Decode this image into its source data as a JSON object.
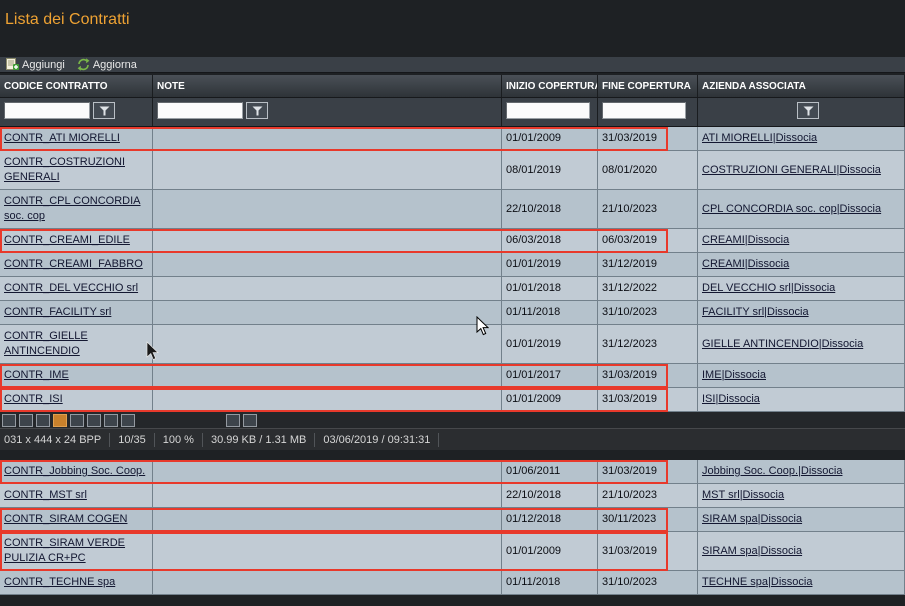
{
  "page": {
    "title": "Lista dei Contratti"
  },
  "toolbar": {
    "add_label": "Aggiungi",
    "refresh_label": "Aggiorna"
  },
  "table": {
    "columns": [
      "CODICE CONTRATTO",
      "NOTE",
      "INIZIO COPERTURA",
      "FINE COPERTURA",
      "AZIENDA ASSOCIATA"
    ],
    "filters": {
      "codice_value": "",
      "note_value": "",
      "inizio_value": "",
      "fine_value": ""
    },
    "action_label": "Dissocia",
    "separator": " | ",
    "rows_top": [
      {
        "codice": "CONTR_ATI MIORELLI",
        "note": "",
        "inizio": "01/01/2009",
        "fine": "31/03/2019",
        "azienda": "ATI MIORELLI",
        "highlight": true
      },
      {
        "codice": "CONTR_COSTRUZIONI GENERALI",
        "note": "",
        "inizio": "08/01/2019",
        "fine": "08/01/2020",
        "azienda": "COSTRUZIONI GENERALI",
        "highlight": false
      },
      {
        "codice": "CONTR_CPL CONCORDIA soc. cop",
        "note": "",
        "inizio": "22/10/2018",
        "fine": "21/10/2023",
        "azienda": "CPL CONCORDIA soc. cop",
        "highlight": false
      },
      {
        "codice": "CONTR_CREAMI_EDILE",
        "note": "",
        "inizio": "06/03/2018",
        "fine": "06/03/2019",
        "azienda": "CREAMI",
        "highlight": true
      },
      {
        "codice": "CONTR_CREAMI_FABBRO",
        "note": "",
        "inizio": "01/01/2019",
        "fine": "31/12/2019",
        "azienda": "CREAMI",
        "highlight": false
      },
      {
        "codice": "CONTR_DEL VECCHIO srl",
        "note": "",
        "inizio": "01/01/2018",
        "fine": "31/12/2022",
        "azienda": "DEL VECCHIO srl",
        "highlight": false
      },
      {
        "codice": "CONTR_FACILITY srl",
        "note": "",
        "inizio": "01/11/2018",
        "fine": "31/10/2023",
        "azienda": "FACILITY srl",
        "highlight": false
      },
      {
        "codice": "CONTR_GIELLE ANTINCENDIO",
        "note": "",
        "inizio": "01/01/2019",
        "fine": "31/12/2023",
        "azienda": "GIELLE ANTINCENDIO",
        "highlight": false
      },
      {
        "codice": "CONTR_IME",
        "note": "",
        "inizio": "01/01/2017",
        "fine": "31/03/2019",
        "azienda": "IME",
        "highlight": true
      },
      {
        "codice": "CONTR_ISI",
        "note": "",
        "inizio": "01/01/2009",
        "fine": "31/03/2019",
        "azienda": "ISI",
        "highlight": true
      }
    ],
    "rows_bottom": [
      {
        "codice": "CONTR_Jobbing Soc. Coop.",
        "note": "",
        "inizio": "01/06/2011",
        "fine": "31/03/2019",
        "azienda": "Jobbing Soc. Coop.",
        "highlight": true
      },
      {
        "codice": "CONTR_MST srl",
        "note": "",
        "inizio": "22/10/2018",
        "fine": "21/10/2023",
        "azienda": "MST srl",
        "highlight": false
      },
      {
        "codice": "CONTR_SIRAM COGEN",
        "note": "",
        "inizio": "01/12/2018",
        "fine": "30/11/2023",
        "azienda": "SIRAM spa",
        "highlight": true
      },
      {
        "codice": "CONTR_SIRAM VERDE PULIZIA CR+PC",
        "note": "",
        "inizio": "01/01/2009",
        "fine": "31/03/2019",
        "azienda": "SIRAM spa",
        "highlight": true
      },
      {
        "codice": "CONTR_TECHNE spa",
        "note": "",
        "inizio": "01/11/2018",
        "fine": "31/10/2023",
        "azienda": "TECHNE spa",
        "highlight": false
      }
    ]
  },
  "statusbar": {
    "items": [
      "031 x 444 x 24 BPP",
      "10/35",
      "100 %",
      "30.99 KB / 1.31 MB",
      "03/06/2019 / 09:31:31"
    ]
  },
  "colors": {
    "title_orange": "#eea233",
    "highlight_red": "#e8392b",
    "row_light": "#b5c2cc",
    "row_alt": "#c1cbd4"
  }
}
